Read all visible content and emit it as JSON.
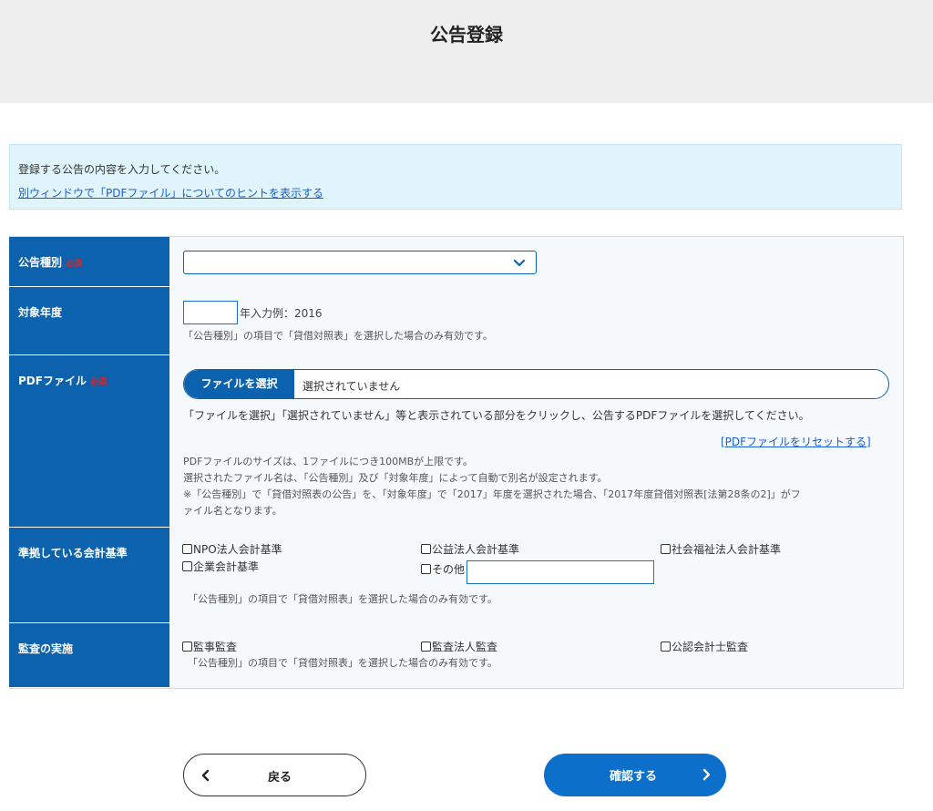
{
  "header": {
    "title": "公告登録"
  },
  "notice": {
    "text": "登録する公告の内容を入力してください。",
    "hint_link": "別ウィンドウで「PDFファイル」についてのヒントを表示する"
  },
  "form": {
    "required_badge": "必須",
    "type": {
      "label": "公告種別",
      "selected": ""
    },
    "year": {
      "label": "対象年度",
      "value": "",
      "hint": "年入力例：2016",
      "note": "「公告種別」の項目で「貸借対照表」を選択した場合のみ有効です。"
    },
    "pdf": {
      "label": "PDFファイル",
      "button": "ファイルを選択",
      "status": "選択されていません",
      "instruction": "「ファイルを選択」「選択されていません」等と表示されている部分をクリックし、公告するPDFファイルを選択してください。",
      "reset_link": "[PDFファイルをリセットする]",
      "note1": "PDFファイルのサイズは、1ファイルにつき100MBが上限です。",
      "note2": "選択されたファイル名は、「公告種別」及び「対象年度」によって自動で別名が設定されます。",
      "note3a": "※「公告種別」で「貸借対照表の公告」を、「対象年度」で「2017」年度を選択された場合、「2017年度貸借対照表[法第28条の2]」がフ",
      "note3b": "ァイル名となります。"
    },
    "standards": {
      "label": "準拠している会計基準",
      "options": [
        "NPO法人会計基準",
        "公益法人会計基準",
        "社会福祉法人会計基準",
        "企業会計基準",
        "その他"
      ],
      "other_value": "",
      "note": "「公告種別」の項目で「貸借対照表」を選択した場合のみ有効です。"
    },
    "audit": {
      "label": "監査の実施",
      "options": [
        "監事監査",
        "監査法人監査",
        "公認会計士監査"
      ],
      "note": "「公告種別」の項目で「貸借対照表」を選択した場合のみ有効です。"
    }
  },
  "actions": {
    "back": "戻る",
    "confirm": "確認する"
  },
  "colors": {
    "primary": "#0c62ad",
    "required": "#e02020",
    "notice_bg": "#dff5fb"
  }
}
